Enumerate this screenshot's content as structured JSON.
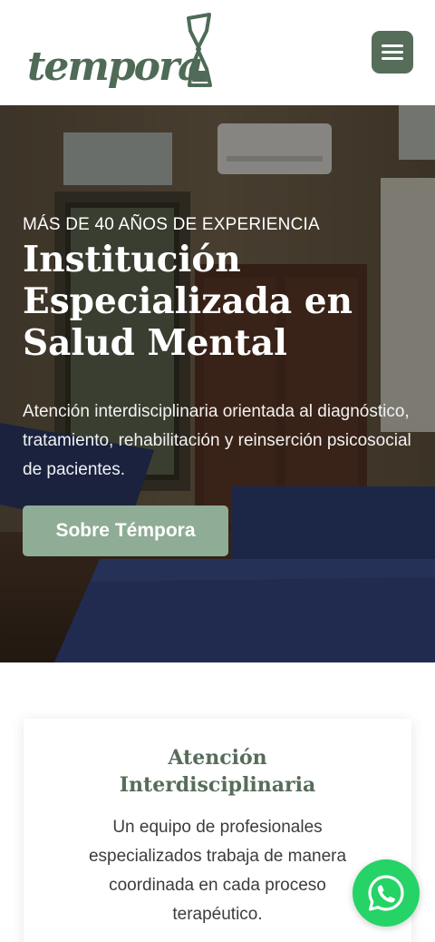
{
  "header": {
    "logo_text": "tempora",
    "menu_icon": "hamburger-menu-icon",
    "brand_color": "#566d5a"
  },
  "hero": {
    "eyebrow": "MÁS DE 40 AÑOS DE EXPERIENCIA",
    "title_lines": [
      "Institución",
      "Especializada en",
      "Salud Mental"
    ],
    "description": "Atención interdisciplinaria orientada al diagnóstico, tratamiento, rehabilitación y reinserción psicosocial de pacientes.",
    "cta_label": "Sobre Témpora",
    "cta_color": "#8fac96"
  },
  "feature_card": {
    "title_lines": [
      "Atención",
      "Interdisciplinaria"
    ],
    "text": "Un equipo de profesionales especializados trabaja de manera coordinada en cada proceso terapéutico."
  },
  "floating": {
    "whatsapp_icon": "whatsapp-icon",
    "whatsapp_color": "#25d366"
  }
}
